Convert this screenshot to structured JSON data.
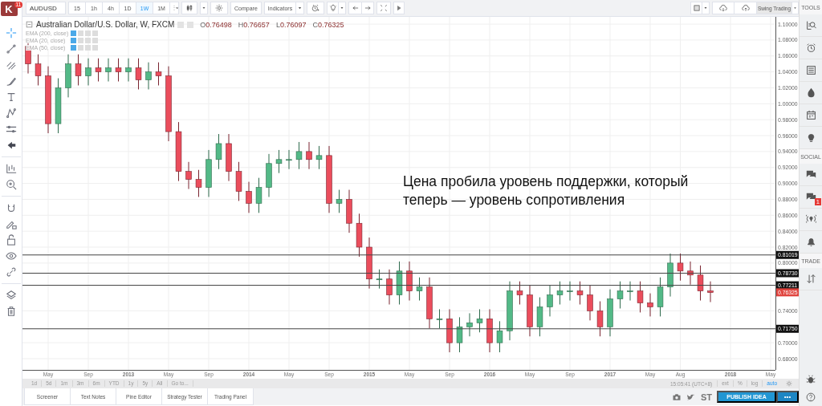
{
  "toolbar": {
    "logo": {
      "letter": "K",
      "badge": "11"
    },
    "symbol": "AUDUSD",
    "intervals": [
      {
        "label": "15",
        "selected": false
      },
      {
        "label": "1h",
        "selected": false
      },
      {
        "label": "4h",
        "selected": false
      },
      {
        "label": "1D",
        "selected": false
      },
      {
        "label": "1W",
        "selected": true
      },
      {
        "label": "1M",
        "selected": false
      }
    ],
    "compare": "Compare",
    "indicators": "Indicators",
    "layout": "Swing Trading"
  },
  "left_toolbar": [
    {
      "selected": true
    },
    {
      "selected": false
    },
    {
      "selected": false
    },
    {
      "selected": false
    },
    {
      "selected": false
    },
    {
      "selected": false
    },
    {
      "selected": false
    },
    {
      "selected": false
    },
    {
      "selected": false
    },
    {
      "selected": false
    },
    {
      "selected": false
    },
    {
      "selected": false
    },
    {
      "selected": false
    },
    {
      "selected": false
    },
    {
      "selected": false
    },
    {
      "selected": false
    },
    {
      "selected": false
    }
  ],
  "legend": {
    "title": "Australian Dollar/U.S. Dollar, W, FXCM",
    "ohlc": [
      {
        "letter": "O",
        "value": "0.76498"
      },
      {
        "letter": "H",
        "value": "0.76657"
      },
      {
        "letter": "L",
        "value": "0.76097"
      },
      {
        "letter": "C",
        "value": "0.76325"
      }
    ],
    "studies": [
      "EMA (200, close)",
      "EMA (20, close)",
      "EMA (50, close)"
    ]
  },
  "chart": {
    "note": "Цена пробила уровень поддержки, который\nтеперь — уровень сопротивления",
    "price_lines": [
      {
        "kind": "line",
        "label": "0.81019"
      },
      {
        "kind": "line",
        "label": "0.78730"
      },
      {
        "kind": "line",
        "label": "0.77211"
      },
      {
        "kind": "last",
        "label": "0.76325"
      },
      {
        "kind": "line",
        "label": "0.71750"
      }
    ],
    "chart_data": {
      "type": "candlestick",
      "grid": true,
      "ylim": [
        0.6659,
        1.1091
      ],
      "categories": [
        null,
        null,
        "May",
        null,
        null,
        null,
        "Sep",
        null,
        null,
        null,
        "2013",
        null,
        null,
        null,
        "May",
        null,
        null,
        null,
        "Sep",
        null,
        null,
        null,
        "2014",
        null,
        null,
        null,
        "May",
        null,
        null,
        null,
        "Sep",
        null,
        null,
        null,
        "2015",
        null,
        null,
        null,
        "May",
        null,
        null,
        null,
        "Sep",
        null,
        null,
        null,
        "2016",
        null,
        null,
        null,
        "May",
        null,
        null,
        null,
        "Sep",
        null,
        null,
        null,
        "2017",
        null,
        null,
        null,
        "May",
        null,
        null,
        "Aug",
        null,
        null,
        null,
        null,
        "2018",
        null,
        null,
        null,
        "May"
      ],
      "ohlc": [
        [
          1.072,
          1.077,
          1.038,
          1.05
        ],
        [
          1.05,
          1.062,
          1.023,
          1.035
        ],
        [
          1.035,
          1.047,
          0.963,
          0.975
        ],
        [
          0.975,
          1.032,
          0.963,
          1.02
        ],
        [
          1.02,
          1.062,
          1.008,
          1.05
        ],
        [
          1.05,
          1.062,
          1.023,
          1.035
        ],
        [
          1.035,
          1.057,
          1.023,
          1.045
        ],
        [
          1.045,
          1.057,
          1.028,
          1.04
        ],
        [
          1.04,
          1.057,
          1.028,
          1.045
        ],
        [
          1.045,
          1.057,
          1.028,
          1.04
        ],
        [
          1.04,
          1.057,
          1.028,
          1.045
        ],
        [
          1.045,
          1.057,
          1.018,
          1.03
        ],
        [
          1.03,
          1.052,
          1.018,
          1.04
        ],
        [
          1.04,
          1.052,
          1.023,
          1.035
        ],
        [
          1.035,
          1.047,
          0.953,
          0.965
        ],
        [
          0.965,
          0.977,
          0.903,
          0.915
        ],
        [
          0.915,
          0.927,
          0.893,
          0.905
        ],
        [
          0.905,
          0.917,
          0.883,
          0.895
        ],
        [
          0.895,
          0.942,
          0.883,
          0.93
        ],
        [
          0.93,
          0.962,
          0.918,
          0.95
        ],
        [
          0.95,
          0.962,
          0.903,
          0.915
        ],
        [
          0.915,
          0.927,
          0.878,
          0.89
        ],
        [
          0.89,
          0.902,
          0.863,
          0.875
        ],
        [
          0.875,
          0.907,
          0.863,
          0.895
        ],
        [
          0.895,
          0.937,
          0.883,
          0.925
        ],
        [
          0.925,
          0.942,
          0.913,
          0.93
        ],
        [
          0.93,
          0.942,
          0.918,
          0.93
        ],
        [
          0.93,
          0.952,
          0.918,
          0.94
        ],
        [
          0.94,
          0.952,
          0.918,
          0.93
        ],
        [
          0.93,
          0.947,
          0.918,
          0.935
        ],
        [
          0.935,
          0.947,
          0.863,
          0.875
        ],
        [
          0.875,
          0.892,
          0.863,
          0.88
        ],
        [
          0.88,
          0.892,
          0.838,
          0.85
        ],
        [
          0.85,
          0.862,
          0.808,
          0.82
        ],
        [
          0.82,
          0.832,
          0.768,
          0.78
        ],
        [
          0.78,
          0.792,
          0.768,
          0.78
        ],
        [
          0.78,
          0.792,
          0.748,
          0.76
        ],
        [
          0.76,
          0.802,
          0.748,
          0.79
        ],
        [
          0.79,
          0.802,
          0.753,
          0.765
        ],
        [
          0.765,
          0.782,
          0.753,
          0.77
        ],
        [
          0.77,
          0.782,
          0.718,
          0.73
        ],
        [
          0.73,
          0.742,
          0.718,
          0.73
        ],
        [
          0.73,
          0.742,
          0.688,
          0.7
        ],
        [
          0.7,
          0.732,
          0.688,
          0.72
        ],
        [
          0.72,
          0.737,
          0.708,
          0.725
        ],
        [
          0.725,
          0.742,
          0.713,
          0.73
        ],
        [
          0.73,
          0.742,
          0.688,
          0.7
        ],
        [
          0.7,
          0.727,
          0.688,
          0.715
        ],
        [
          0.715,
          0.777,
          0.703,
          0.765
        ],
        [
          0.765,
          0.777,
          0.748,
          0.76
        ],
        [
          0.76,
          0.772,
          0.708,
          0.72
        ],
        [
          0.72,
          0.757,
          0.708,
          0.745
        ],
        [
          0.745,
          0.772,
          0.733,
          0.76
        ],
        [
          0.76,
          0.777,
          0.748,
          0.765
        ],
        [
          0.765,
          0.777,
          0.753,
          0.765
        ],
        [
          0.765,
          0.777,
          0.748,
          0.76
        ],
        [
          0.76,
          0.772,
          0.728,
          0.74
        ],
        [
          0.74,
          0.752,
          0.708,
          0.72
        ],
        [
          0.72,
          0.767,
          0.708,
          0.755
        ],
        [
          0.755,
          0.777,
          0.743,
          0.765
        ],
        [
          0.765,
          0.777,
          0.753,
          0.765
        ],
        [
          0.765,
          0.777,
          0.738,
          0.75
        ],
        [
          0.75,
          0.762,
          0.733,
          0.745
        ],
        [
          0.745,
          0.782,
          0.733,
          0.77
        ],
        [
          0.77,
          0.812,
          0.758,
          0.8
        ],
        [
          0.8,
          0.812,
          0.778,
          0.79
        ],
        [
          0.79,
          0.802,
          0.773,
          0.785
        ],
        [
          0.785,
          0.797,
          0.753,
          0.765
        ],
        [
          0.765,
          0.777,
          0.751,
          0.763
        ],
        null,
        null,
        null,
        null,
        null,
        null
      ],
      "yticks": [
        {
          "value": 0.68,
          "label": "0.68000"
        },
        {
          "value": 0.7,
          "label": "0.70000"
        },
        {
          "value": 0.74,
          "label": "0.74000"
        },
        {
          "value": 0.8,
          "label": "0.80000"
        },
        {
          "value": 0.82,
          "label": "0.82000"
        },
        {
          "value": 0.84,
          "label": "0.84000"
        },
        {
          "value": 0.86,
          "label": "0.86000"
        },
        {
          "value": 0.88,
          "label": "0.88000"
        },
        {
          "value": 0.9,
          "label": "0.90000"
        },
        {
          "value": 0.92,
          "label": "0.92000"
        },
        {
          "value": 0.94,
          "label": "0.94000"
        },
        {
          "value": 0.96,
          "label": "0.96000"
        },
        {
          "value": 0.98,
          "label": "0.98000"
        },
        {
          "value": 1.0,
          "label": "1.00000"
        },
        {
          "value": 1.02,
          "label": "1.02000"
        },
        {
          "value": 1.04,
          "label": "1.04000"
        },
        {
          "value": 1.06,
          "label": "1.06000"
        },
        {
          "value": 1.08,
          "label": "1.08000"
        },
        {
          "value": 1.1,
          "label": "1.10000"
        }
      ]
    }
  },
  "range_bar": {
    "ranges": [
      "1d",
      "5d",
      "1m",
      "3m",
      "6m",
      "YTD",
      "1y",
      "5y",
      "All",
      "Go to..."
    ],
    "time": "15:05:41 (UTC+8)",
    "options": [
      {
        "label": "ext",
        "selected": false
      },
      {
        "label": "%",
        "selected": false
      },
      {
        "label": "log",
        "selected": false
      },
      {
        "label": "auto",
        "selected": true
      }
    ]
  },
  "bottom_tabs": [
    "Screener",
    "Text Notes",
    "Pine Editor",
    "Strategy Tester",
    "Trading Panel"
  ],
  "share": {
    "st": "ST",
    "publish": "PUBLISH IDEA",
    "more": "•••"
  },
  "right_sidebar": [
    {
      "kind": "header",
      "label": "TOOLS"
    },
    {
      "kind": "icon"
    },
    {
      "kind": "icon"
    },
    {
      "kind": "icon"
    },
    {
      "kind": "icon"
    },
    {
      "kind": "icon"
    },
    {
      "kind": "icon"
    },
    {
      "kind": "header",
      "label": "SOCIAL"
    },
    {
      "kind": "icon"
    },
    {
      "kind": "icon",
      "badge": "1"
    },
    {
      "kind": "icon"
    },
    {
      "kind": "icon"
    },
    {
      "kind": "header",
      "label": "TRADE"
    },
    {
      "kind": "icon"
    }
  ]
}
